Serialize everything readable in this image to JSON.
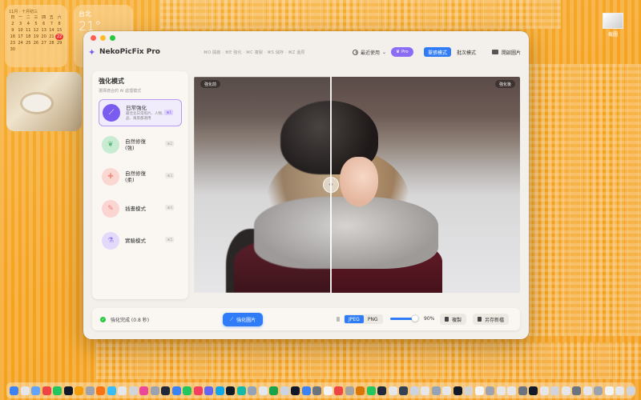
{
  "desktop": {
    "calendar": {
      "month": "11月 · 十月初三",
      "weekdays": [
        "日",
        "一",
        "二",
        "三",
        "四",
        "五",
        "六"
      ],
      "weeks": [
        [
          "2",
          "3",
          "4",
          "5",
          "6",
          "7",
          "8"
        ],
        [
          "9",
          "10",
          "11",
          "12",
          "13",
          "14",
          "15"
        ],
        [
          "16",
          "17",
          "18",
          "19",
          "20",
          "21",
          "22"
        ],
        [
          "23",
          "24",
          "25",
          "26",
          "27",
          "28",
          "29"
        ],
        [
          "30",
          "",
          "",
          "",
          "",
          "",
          ""
        ]
      ],
      "today": "22"
    },
    "weather": {
      "city": "台北",
      "temp": "21°"
    },
    "desktop_icon_label": "截圖"
  },
  "window": {
    "title": "NekoPicFix Pro",
    "shortcut_hint": "⌘O 開啟 · ⌘E 強化 · ⌘C 複製 · ⌘S 儲存 · ⌘Z 還原",
    "recent_label": "最近使用",
    "pro_label": "Pro",
    "mode_single": "單張模式",
    "mode_batch": "批次模式",
    "open_label": "開啟圖片"
  },
  "sidebar": {
    "title": "強化模式",
    "subtitle": "選擇適合的 AI 處理模式",
    "modes": [
      {
        "name": "日常強化",
        "desc": "最佳化日常照片、人物、物品、風景都適用",
        "key": "⌘1",
        "color": "#7a5cf0",
        "icon": "wand-icon"
      },
      {
        "name": "自然修復\n(強)",
        "desc": "",
        "key": "⌘2",
        "color": "#8fd3a6",
        "icon": "leaf-icon"
      },
      {
        "name": "自然修復\n(柔)",
        "desc": "",
        "key": "⌘3",
        "color": "#f4a7a0",
        "icon": "sparkle-icon"
      },
      {
        "name": "插畫模式",
        "desc": "",
        "key": "⌘4",
        "color": "#f2a09c",
        "icon": "brush-icon"
      },
      {
        "name": "實驗模式",
        "desc": "",
        "key": "⌘5",
        "color": "#b9a3f2",
        "icon": "flask-icon"
      }
    ]
  },
  "preview": {
    "before_label": "強化前",
    "after_label": "強化後",
    "handle_label": "‹ ›",
    "split": 0.42
  },
  "bottombar": {
    "status": "強化完成 (0.8 秒)",
    "enhance_label": "強化圖片",
    "formats": [
      "JPEG",
      "PNG"
    ],
    "selected_format": "JPEG",
    "quality": 0.9,
    "quality_label": "90%",
    "copy_label": "複製",
    "save_label": "另存新檔"
  },
  "colors": {
    "accent": "#2f7cf6",
    "pro": "#8b6cf6",
    "desktop": "#f5a623"
  }
}
